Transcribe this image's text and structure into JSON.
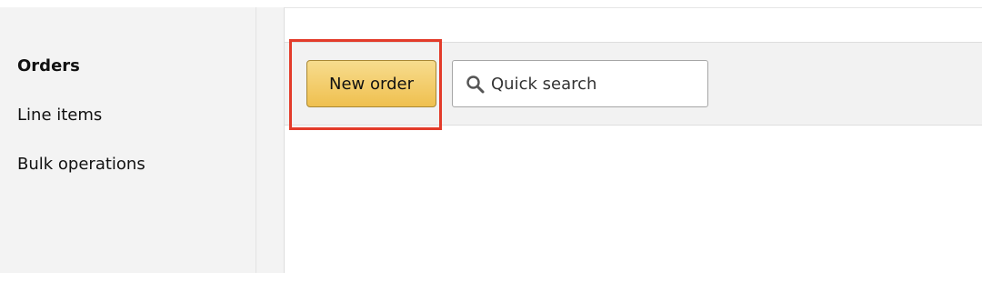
{
  "sidebar": {
    "items": [
      {
        "label": "Orders",
        "active": true
      },
      {
        "label": "Line items",
        "active": false
      },
      {
        "label": "Bulk operations",
        "active": false
      }
    ]
  },
  "toolbar": {
    "new_order_label": "New order",
    "search": {
      "placeholder": "Quick search",
      "value": "",
      "icon": "search-icon"
    }
  },
  "colors": {
    "primary_button": "#f0c14b",
    "highlight": "#e33b2a",
    "sidebar_bg": "#f3f3f3",
    "toolbar_bg": "#f2f2f2"
  }
}
